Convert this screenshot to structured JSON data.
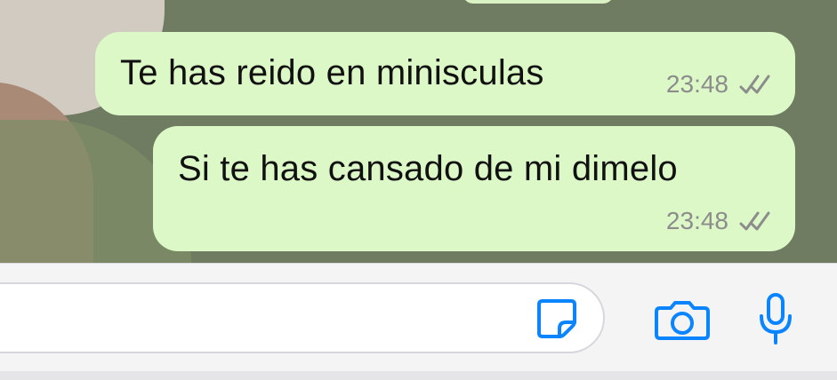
{
  "theme": {
    "outgoing_bubble": "#dcf8c6",
    "accent": "#0a84ff",
    "meta_text": "#8c8c8c",
    "wallpaper": "#6f7c61"
  },
  "messages": [
    {
      "text": "Te has reido en minisculas",
      "time": "23:48",
      "status_icon": "double-check-icon"
    },
    {
      "text": "Si te has cansado de mi dimelo",
      "time": "23:48",
      "status_icon": "double-check-icon"
    }
  ],
  "composer": {
    "value": "",
    "icons": {
      "sticker": "sticker-icon",
      "camera": "camera-icon",
      "microphone": "microphone-icon"
    }
  }
}
